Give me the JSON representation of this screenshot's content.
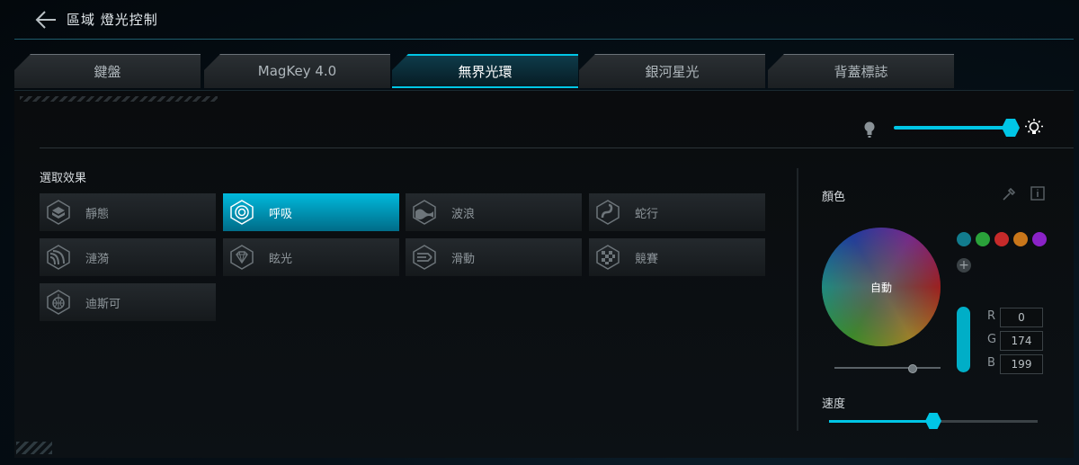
{
  "header": {
    "title": "區域 燈光控制",
    "back_icon": "arrow-left-icon"
  },
  "tabs": [
    {
      "label": "鍵盤",
      "active": false
    },
    {
      "label": "MagKey 4.0",
      "active": false
    },
    {
      "label": "無界光環",
      "active": true
    },
    {
      "label": "銀河星光",
      "active": false
    },
    {
      "label": "背蓋標誌",
      "active": false
    }
  ],
  "brightness": {
    "level_percent": 100,
    "low_icon": "bulb-icon",
    "high_icon": "sun-icon"
  },
  "effects": {
    "title": "選取效果",
    "items": [
      {
        "label": "靜態",
        "icon": "static-icon",
        "active": false
      },
      {
        "label": "呼吸",
        "icon": "breathing-icon",
        "active": true
      },
      {
        "label": "波浪",
        "icon": "wave-icon",
        "active": false
      },
      {
        "label": "蛇行",
        "icon": "snake-icon",
        "active": false
      },
      {
        "label": "漣漪",
        "icon": "ripple-icon",
        "active": false
      },
      {
        "label": "眩光",
        "icon": "diamond-icon",
        "active": false
      },
      {
        "label": "滑動",
        "icon": "slide-icon",
        "active": false
      },
      {
        "label": "競賽",
        "icon": "race-flag-icon",
        "active": false
      },
      {
        "label": "迪斯可",
        "icon": "disco-icon",
        "active": false
      }
    ]
  },
  "color": {
    "title": "顏色",
    "wheel_label": "自動",
    "swatches": [
      "#127c8e",
      "#2aa23a",
      "#c62a2a",
      "#c9761a",
      "#8a22c7"
    ],
    "current": "#00aec7",
    "r": "0",
    "g": "174",
    "b": "199",
    "r_label": "R",
    "g_label": "G",
    "b_label": "B"
  },
  "speed": {
    "title": "速度",
    "level_percent": 50
  },
  "colors": {
    "accent": "#00c6e6",
    "active_tile": "#00b9dc"
  }
}
